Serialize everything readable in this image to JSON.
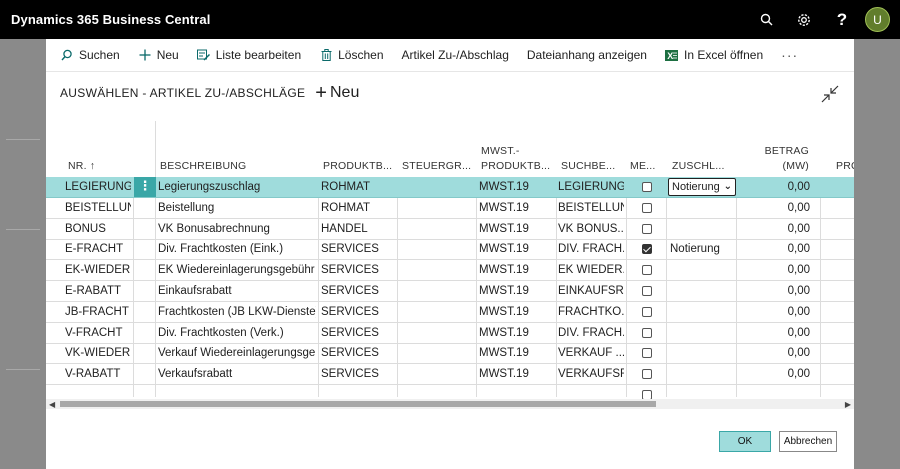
{
  "app": {
    "title": "Dynamics 365 Business Central",
    "avatar_initial": "U",
    "accent": "#3aa7a7",
    "selected_row_color": "#9fdcdc"
  },
  "header_icons": [
    "search-icon",
    "gear-icon",
    "help-icon"
  ],
  "help_label": "?",
  "actions": [
    {
      "label": "Suchen",
      "icon": "search-icon"
    },
    {
      "label": "Neu",
      "icon": "plus-icon"
    },
    {
      "label": "Liste bearbeiten",
      "icon": "edit-list-icon"
    },
    {
      "label": "Löschen",
      "icon": "trash-icon"
    },
    {
      "label": "Artikel Zu-/Abschlag",
      "icon": ""
    },
    {
      "label": "Dateianhang anzeigen",
      "icon": ""
    },
    {
      "label": "In Excel öffnen",
      "icon": "excel-icon"
    }
  ],
  "more_label": "···",
  "page": {
    "title": "AUSWÄHLEN - ARTIKEL ZU-/ABSCHLÄGE",
    "new_label": "Neu"
  },
  "columns": {
    "nr": "NR. ↑",
    "beschreibung": "BESCHREIBUNG",
    "produktb": "PRODUKTB...",
    "steuergr": "STEUERGR...",
    "mwst_l1": "MWST.-",
    "mwst_l2": "PRODUKTB...",
    "suchbe": "SUCHBE...",
    "me": "ME...",
    "zuschl": "ZUSCHL...",
    "betrag_l1": "BETRAG",
    "betrag_l2": "(MW)",
    "pro": "PRO"
  },
  "rows": [
    {
      "nr": "LEGIERUNG...",
      "beschreibung": "Legierungszuschlag",
      "produktb": "ROHMAT",
      "mwst": "MWST.19",
      "suchbe": "LEGIERUNG...",
      "checked": false,
      "zuschl": "Notierung",
      "betrag": "0,00"
    },
    {
      "nr": "BEISTELLUNG",
      "beschreibung": "Beistellung",
      "produktb": "ROHMAT",
      "mwst": "MWST.19",
      "suchbe": "BEISTELLUNG",
      "checked": false,
      "zuschl": "",
      "betrag": "0,00"
    },
    {
      "nr": "BONUS",
      "beschreibung": "VK Bonusabrechnung",
      "produktb": "HANDEL",
      "mwst": "MWST.19",
      "suchbe": "VK BONUS...",
      "checked": false,
      "zuschl": "",
      "betrag": "0,00"
    },
    {
      "nr": "E-FRACHT",
      "beschreibung": "Div. Frachtkosten (Eink.)",
      "produktb": "SERVICES",
      "mwst": "MWST.19",
      "suchbe": "DIV. FRACH...",
      "checked": true,
      "zuschl": "Notierung",
      "betrag": "0,00"
    },
    {
      "nr": "EK-WIEDER...",
      "beschreibung": "EK Wiedereinlagerungsgebühr",
      "produktb": "SERVICES",
      "mwst": "MWST.19",
      "suchbe": "EK WIEDER...",
      "checked": false,
      "zuschl": "",
      "betrag": "0,00"
    },
    {
      "nr": "E-RABATT",
      "beschreibung": "Einkaufsrabatt",
      "produktb": "SERVICES",
      "mwst": "MWST.19",
      "suchbe": "EINKAUFSR...",
      "checked": false,
      "zuschl": "",
      "betrag": "0,00"
    },
    {
      "nr": "JB-FRACHT",
      "beschreibung": "Frachtkosten (JB LKW-Dienste)",
      "produktb": "SERVICES",
      "mwst": "MWST.19",
      "suchbe": "FRACHTKO...",
      "checked": false,
      "zuschl": "",
      "betrag": "0,00"
    },
    {
      "nr": "V-FRACHT",
      "beschreibung": "Div. Frachtkosten (Verk.)",
      "produktb": "SERVICES",
      "mwst": "MWST.19",
      "suchbe": "DIV. FRACH...",
      "checked": false,
      "zuschl": "",
      "betrag": "0,00"
    },
    {
      "nr": "VK-WIEDER...",
      "beschreibung": "Verkauf Wiedereinlagerungsge...",
      "produktb": "SERVICES",
      "mwst": "MWST.19",
      "suchbe": "VERKAUF ...",
      "checked": false,
      "zuschl": "",
      "betrag": "0,00"
    },
    {
      "nr": "V-RABATT",
      "beschreibung": "Verkaufsrabatt",
      "produktb": "SERVICES",
      "mwst": "MWST.19",
      "suchbe": "VERKAUFSR...",
      "checked": false,
      "zuschl": "",
      "betrag": "0,00"
    },
    {
      "nr": "",
      "beschreibung": "",
      "produktb": "",
      "mwst": "",
      "suchbe": "",
      "checked": false,
      "zuschl": "",
      "betrag": ""
    }
  ],
  "buttons": {
    "ok": "OK",
    "cancel": "Abbrechen"
  }
}
